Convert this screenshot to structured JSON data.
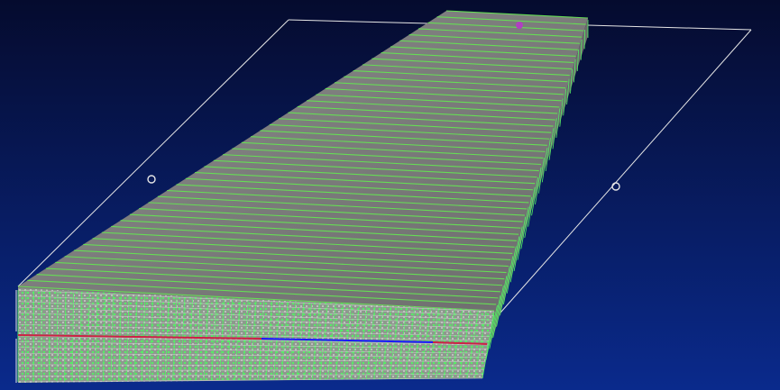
{
  "viewer": {
    "background_top": "#050b2e",
    "background_bottom": "#0a2a8c",
    "mesh_skin_color": "#7a7a7a",
    "mesh_line_color": "#66dd55",
    "mesh_node_color": "#55ee66",
    "spar_face_color": "#9a9a9a",
    "midline_color_a": "#1a1aff",
    "midline_color_b": "#cc2244",
    "frame_color": "#e6e6e6",
    "tip_marker_color": "#b040c0"
  }
}
